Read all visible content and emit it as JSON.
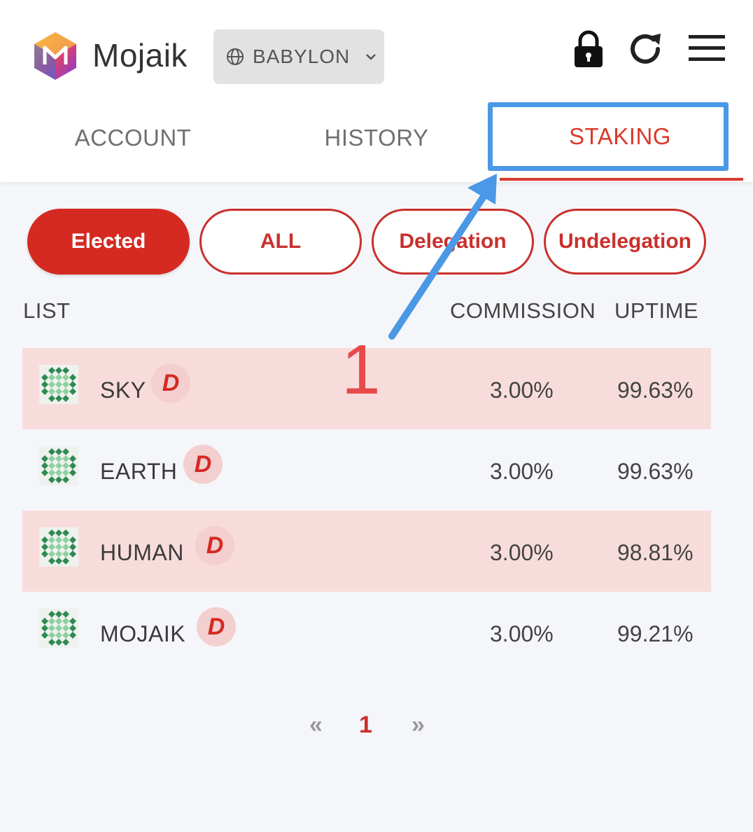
{
  "app": {
    "name": "Mojaik"
  },
  "network": {
    "selected": "BABYLON"
  },
  "tabs": [
    {
      "label": "ACCOUNT"
    },
    {
      "label": "HISTORY"
    },
    {
      "label": "STAKING",
      "active": true
    }
  ],
  "filters": [
    {
      "label": "Elected",
      "active": true
    },
    {
      "label": "ALL"
    },
    {
      "label": "Delegation"
    },
    {
      "label": "Undelegation"
    }
  ],
  "columns": {
    "list": "LIST",
    "commission": "COMMISSION",
    "uptime": "UPTIME"
  },
  "validators": [
    {
      "name": "SKY",
      "badge": "D",
      "commission": "3.00%",
      "uptime": "99.63%"
    },
    {
      "name": "EARTH",
      "badge": "D",
      "commission": "3.00%",
      "uptime": "99.63%"
    },
    {
      "name": "HUMAN",
      "badge": "D",
      "commission": "3.00%",
      "uptime": "98.81%"
    },
    {
      "name": "MOJAIK",
      "badge": "D",
      "commission": "3.00%",
      "uptime": "99.21%"
    }
  ],
  "pagination": {
    "prev": "«",
    "current": "1",
    "next": "»"
  },
  "annotation": {
    "step": "1"
  },
  "colors": {
    "accent": "#d42a22",
    "annotation": "#4a98e6",
    "row_highlight": "#f8dcdc"
  },
  "icons": [
    "mojaik-logo-icon",
    "globe-icon",
    "chevron-down-icon",
    "lock-icon",
    "refresh-icon",
    "menu-icon",
    "validator-avatar-icon"
  ]
}
